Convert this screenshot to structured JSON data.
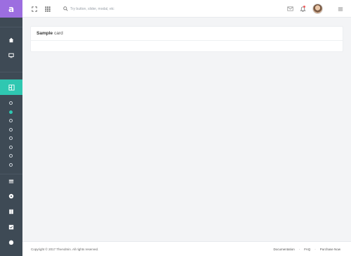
{
  "brand": {
    "logo_letter": "a",
    "color": "#9c6ee0"
  },
  "sidebar": {
    "background": "#3e4a55",
    "accent": "#2fc7b1",
    "icons": [
      "home-icon",
      "monitor-icon",
      "layout-icon",
      "list-icon",
      "disc-icon",
      "book-icon",
      "checkbox-icon",
      "chat-icon"
    ],
    "sub_items_count": 8,
    "active_sub_item": 1
  },
  "topbar": {
    "search": {
      "placeholder": "Try button, slider, modal, etc"
    },
    "icons": [
      "fullscreen-icon",
      "apps-grid-icon",
      "search-icon",
      "mail-icon",
      "bell-icon",
      "menu-icon"
    ]
  },
  "card": {
    "title_bold": "Sample",
    "title_rest": "card"
  },
  "footer": {
    "copyright": "Copyright © 2017 TheAdmin. All rights reserved.",
    "links": [
      "Documentation",
      "FAQ",
      "Purchase Now"
    ]
  }
}
